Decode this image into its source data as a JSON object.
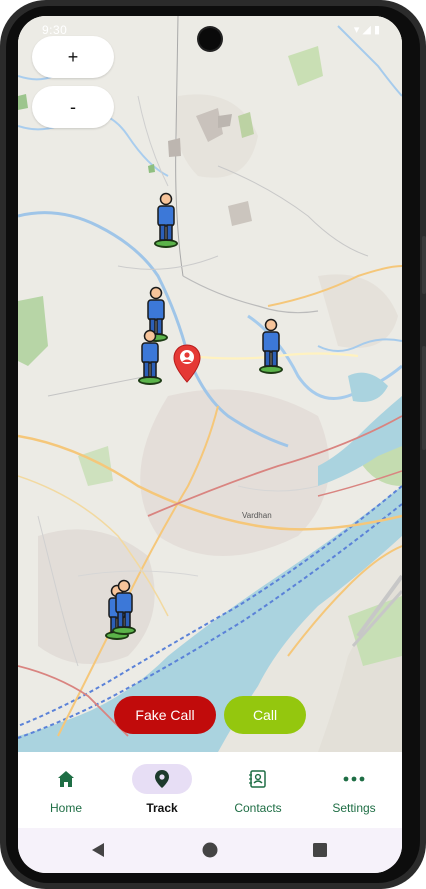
{
  "status_bar": {
    "time": "9:30",
    "icons": [
      "wifi-icon",
      "signal-icon",
      "battery-icon"
    ]
  },
  "zoom": {
    "in_label": "+",
    "out_label": "-"
  },
  "map": {
    "place_labels": [
      "Vardhan"
    ],
    "markers": {
      "people_count": 6,
      "current_location": "location-pin-icon"
    }
  },
  "actions": {
    "fake_call_label": "Fake Call",
    "call_label": "Call",
    "fake_call_color": "#c10b0b",
    "call_color": "#94c70e"
  },
  "bottom_nav": {
    "items": [
      {
        "label": "Home",
        "icon": "home-icon",
        "active": false
      },
      {
        "label": "Track",
        "icon": "location-pin-icon",
        "active": true
      },
      {
        "label": "Contacts",
        "icon": "contacts-icon",
        "active": false
      },
      {
        "label": "Settings",
        "icon": "more-icon",
        "active": false
      }
    ],
    "accent_color": "#1f6e45",
    "active_pill_color": "#e7def5"
  },
  "system_nav": {
    "buttons": [
      "back-icon",
      "home-circle-icon",
      "recents-icon"
    ]
  }
}
